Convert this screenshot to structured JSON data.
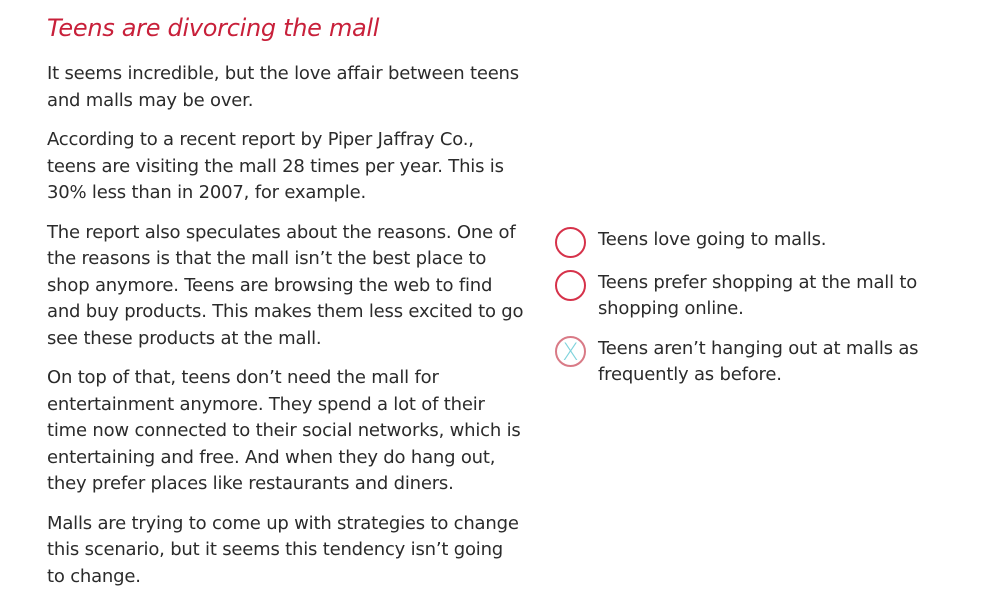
{
  "title": "Teens are divorcing the mall",
  "paragraphs": [
    "It seems incredible, but the love affair between teens and malls may be over.",
    "According to a recent report by Piper Jaffray Co., teens are visiting the mall 28 times per year. This is 30% less than in 2007, for example.",
    "The report also speculates about the reasons. One of the reasons is that the mall isn’t the best place to shop anymore. Teens are browsing the web to find and buy products. This makes them less excited to go see these products at the mall.",
    "On top of that, teens don’t need the mall for entertainment anymore. They spend a lot of their time now connected to their social networks, which is entertaining and free. And when they do hang out, they prefer places like restaurants and diners.",
    "Malls are trying to come up with strategies to change this scenario, but it seems this tendency isn’t going to change."
  ],
  "options": [
    {
      "text": "Teens love going to malls.",
      "selected": false,
      "mark": ""
    },
    {
      "text": "Teens prefer shopping at the mall to shopping online.",
      "selected": false,
      "mark": ""
    },
    {
      "text": "Teens aren’t hanging out at malls as frequently as before.",
      "selected": true,
      "mark": "X"
    }
  ],
  "colors": {
    "title": "#c8203a",
    "radio_border": "#d6324a",
    "mark": "#7fd3dc",
    "text": "#2b2b2b"
  }
}
